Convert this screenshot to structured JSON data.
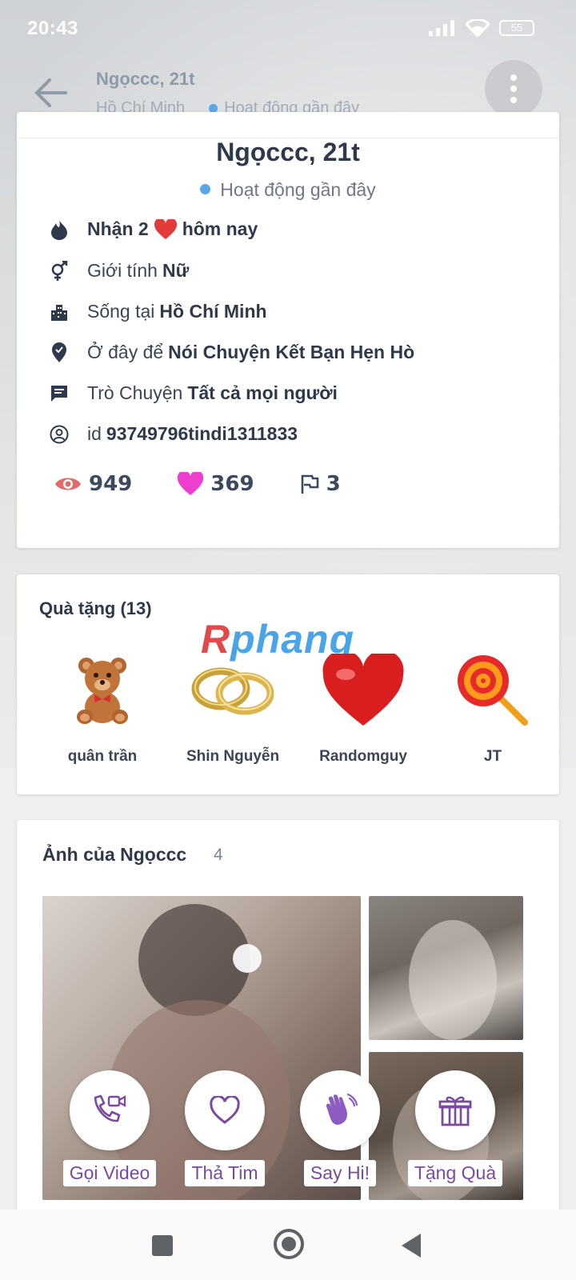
{
  "status_bar": {
    "time": "20:43",
    "battery": "55"
  },
  "header": {
    "title": "Ngọccc, 21t",
    "location": "Hồ Chí Minh",
    "activity": "Hoạt động gần đây"
  },
  "profile": {
    "name": "Ngọccc, 21t",
    "activity": "Hoạt động gần đây",
    "likes_today": {
      "prefix": "Nhận 2",
      "suffix": "hôm nay"
    },
    "gender": {
      "label": "Giới tính",
      "value": "Nữ"
    },
    "lives": {
      "label": "Sống tại",
      "value": "Hồ Chí Minh"
    },
    "purpose": {
      "label": "Ở đây để",
      "value": "Nói Chuyện Kết Bạn Hẹn Hò"
    },
    "chat": {
      "label": "Trò Chuyện",
      "value": "Tất cả mọi người"
    },
    "id": {
      "label": "id",
      "value": "93749796tindi1311833"
    },
    "stats": {
      "views": "949",
      "hearts": "369",
      "flags": "3"
    }
  },
  "gifts": {
    "title": "Quà tặng (13)",
    "watermark": {
      "a": "R",
      "b": "phang"
    },
    "items": [
      {
        "from": "quân trần",
        "icon": "teddy-bear-icon"
      },
      {
        "from": "Shin Nguyễn",
        "icon": "rings-icon"
      },
      {
        "from": "Randomguy",
        "icon": "heart-icon"
      },
      {
        "from": "JT",
        "icon": "lollipop-icon"
      }
    ]
  },
  "photos": {
    "title": "Ảnh của Ngọccc",
    "count": "4"
  },
  "actions": {
    "video_call": "Gọi Video",
    "heart": "Thả Tim",
    "say_hi": "Say Hi!",
    "gift": "Tặng Quà"
  },
  "colors": {
    "accent": "#7a4aa0",
    "online_dot": "#5aa6e6",
    "heart": "#ec3fd0",
    "eye": "#e46a6a"
  }
}
